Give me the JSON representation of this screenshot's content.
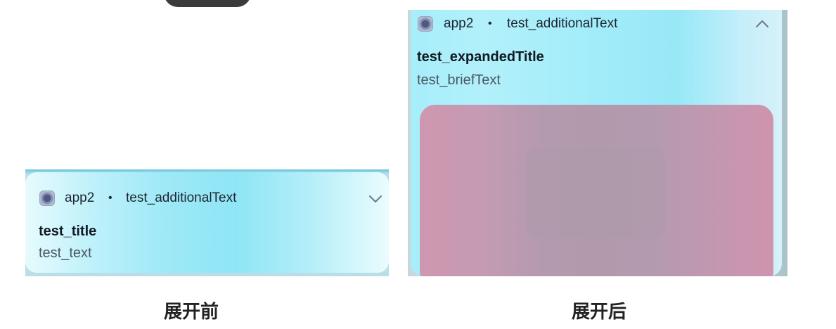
{
  "collapsed": {
    "app_name": "app2",
    "separator": "•",
    "additional_text": "test_additionalText",
    "title": "test_title",
    "text": "test_text",
    "toggle_icon": "chevron-down-icon"
  },
  "expanded": {
    "app_name": "app2",
    "separator": "•",
    "additional_text": "test_additionalText",
    "expanded_title": "test_expandedTitle",
    "brief_text": "test_briefText",
    "toggle_icon": "chevron-up-icon"
  },
  "captions": {
    "before": "展开前",
    "after": "展开后"
  },
  "colors": {
    "card_accent": "#9fe9f7",
    "picture": "#b49aae"
  }
}
